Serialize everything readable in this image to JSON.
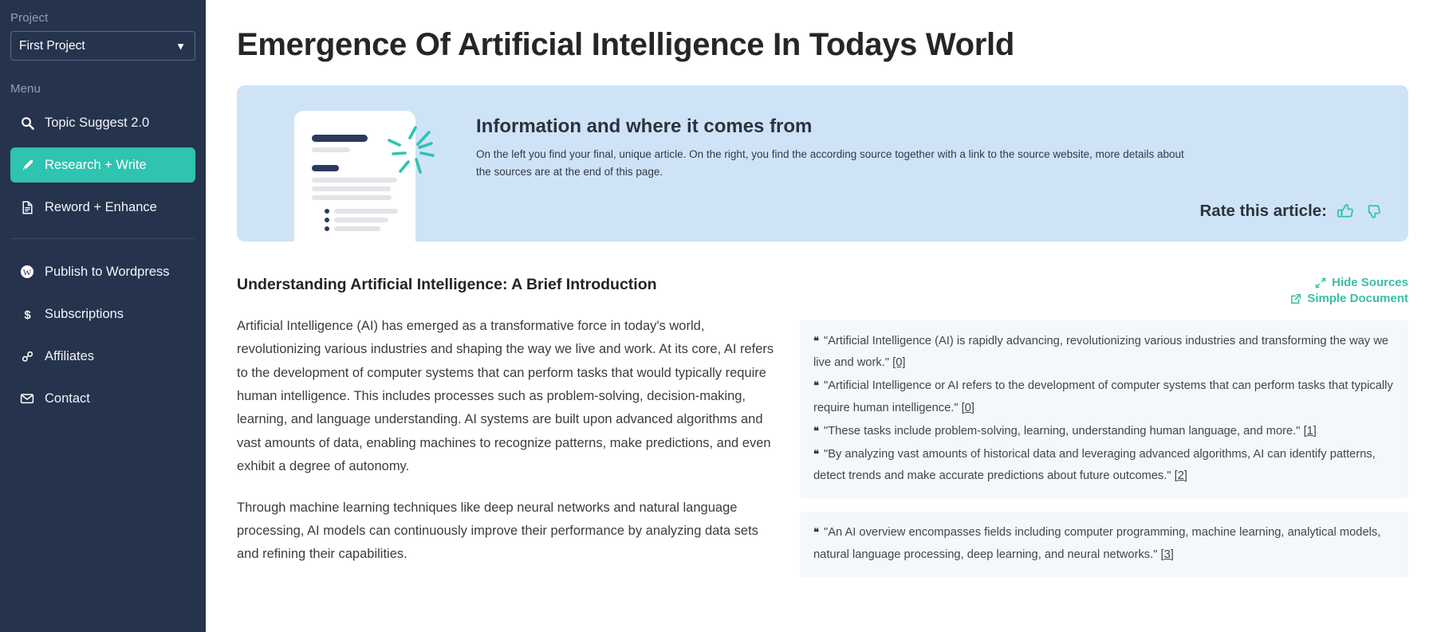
{
  "sidebar": {
    "project_label": "Project",
    "project_selected": "First Project",
    "menu_label": "Menu",
    "items": [
      {
        "label": "Topic Suggest 2.0",
        "icon": "search-icon",
        "active": false
      },
      {
        "label": "Research + Write",
        "icon": "pen-icon",
        "active": true
      },
      {
        "label": "Reword + Enhance",
        "icon": "document-icon",
        "active": false
      }
    ],
    "items_secondary": [
      {
        "label": "Publish to Wordpress",
        "icon": "wordpress-icon"
      },
      {
        "label": "Subscriptions",
        "icon": "dollar-icon"
      },
      {
        "label": "Affiliates",
        "icon": "link-icon"
      },
      {
        "label": "Contact",
        "icon": "envelope-icon"
      }
    ]
  },
  "page": {
    "title": "Emergence Of Artificial Intelligence In Todays World"
  },
  "banner": {
    "title": "Information and where it comes from",
    "description": "On the left you find your final, unique article. On the right, you find the according source together with a link to the source website, more details about the sources are at the end of this page.",
    "rate_label": "Rate this article:",
    "thumbs_up_icon": "thumbs-up-icon",
    "thumbs_down_icon": "thumbs-down-icon",
    "bg_color": "#cfe3f7"
  },
  "article": {
    "heading": "Understanding Artificial Intelligence: A Brief Introduction",
    "paragraphs": [
      "Artificial Intelligence (AI) has emerged as a transformative force in today's world, revolutionizing various industries and shaping the way we live and work. At its core, AI refers to the development of computer systems that can perform tasks that would typically require human intelligence. This includes processes such as problem-solving, decision-making, learning, and language understanding. AI systems are built upon advanced algorithms and vast amounts of data, enabling machines to recognize patterns, make predictions, and even exhibit a degree of autonomy.",
      "Through machine learning techniques like deep neural networks and natural language processing, AI models can continuously improve their performance by analyzing data sets and refining their capabilities."
    ]
  },
  "sources": {
    "hide_sources_label": "Hide Sources",
    "simple_document_label": "Simple Document",
    "accent_color": "#3bbfa4",
    "cards": [
      {
        "quotes": [
          {
            "text": "\"Artificial Intelligence (AI) is rapidly advancing, revolutionizing various industries and transforming the way we live and work.\"",
            "ref": "[0]"
          },
          {
            "text": "\"Artificial Intelligence or AI refers to the development of computer systems that can perform tasks that typically require human intelligence.\"",
            "ref": "[0]"
          },
          {
            "text": "\"These tasks include problem-solving, learning, understanding human language, and more.\"",
            "ref": "[1]"
          },
          {
            "text": "\"By analyzing vast amounts of historical data and leveraging advanced algorithms, AI can identify patterns, detect trends and make accurate predictions about future outcomes.\"",
            "ref": "[2]"
          }
        ]
      },
      {
        "quotes": [
          {
            "text": "\"An AI overview encompasses fields including computer programming, machine learning, analytical models, natural language processing, deep learning, and neural networks.\"",
            "ref": "[3]"
          }
        ]
      }
    ]
  }
}
